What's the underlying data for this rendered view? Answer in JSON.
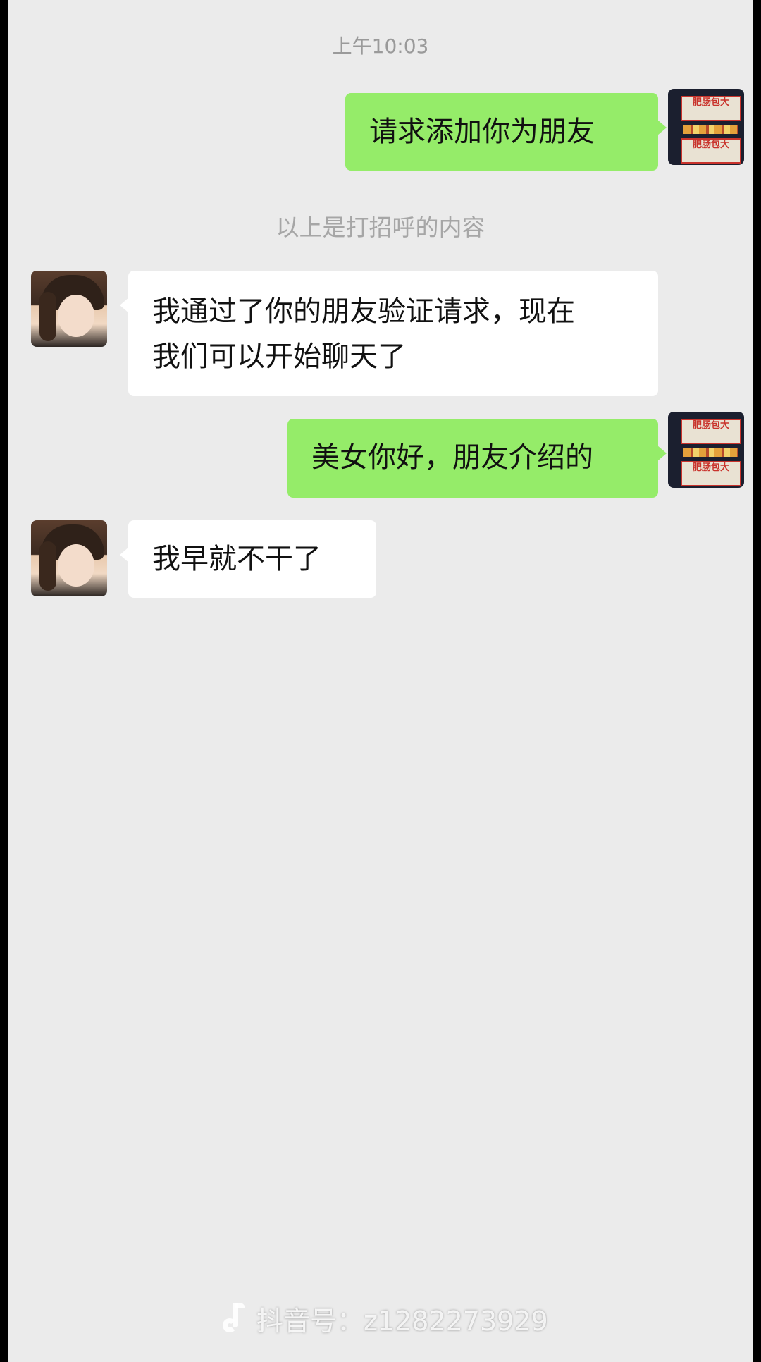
{
  "chat": {
    "timestamp": "上午10:03",
    "system_note": "以上是打招呼的内容",
    "self_avatar_sign": "肥肠包大",
    "messages": [
      {
        "from": "self",
        "text": "请求添加你为朋友"
      },
      {
        "from": "other",
        "line1": "我通过了你的朋友验证请求，现在",
        "line2": "我们可以开始聊天了"
      },
      {
        "from": "self",
        "text": "美女你好，朋友介绍的"
      },
      {
        "from": "other",
        "text": "我早就不干了"
      }
    ]
  },
  "watermark": {
    "icon": "tiktok-icon",
    "text": "抖音号：z1282273929"
  },
  "colors": {
    "sent_bubble": "#95ec69",
    "recv_bubble": "#ffffff",
    "background": "#ebebeb"
  }
}
